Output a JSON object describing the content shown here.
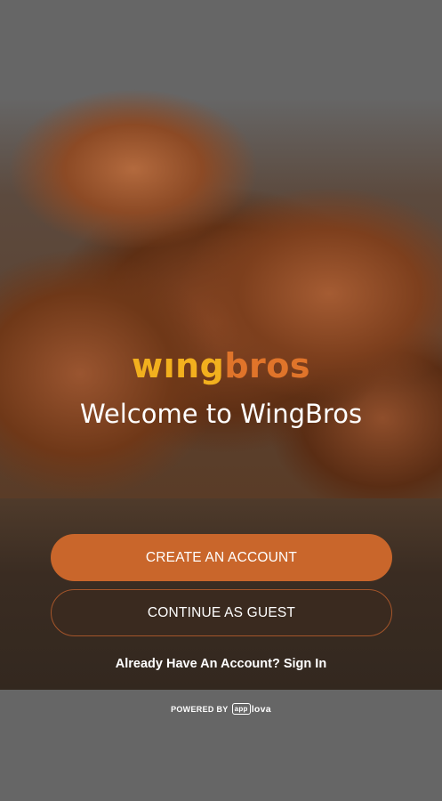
{
  "brand": {
    "logo_part1": "wıng",
    "logo_part2": "bros",
    "welcome": "Welcome to WingBros"
  },
  "actions": {
    "create_account": "CREATE AN ACCOUNT",
    "continue_guest": "CONTINUE AS GUEST",
    "sign_in": "Already Have An Account? Sign In"
  },
  "footer": {
    "powered_by": "POWERED BY",
    "vendor_box": "app",
    "vendor_rest": "lova"
  },
  "colors": {
    "logo_yellow": "#f2b01e",
    "logo_orange": "#e0742a",
    "primary_button": "#c9662b",
    "secondary_button": "#3a2a1f",
    "background": "#666666"
  }
}
